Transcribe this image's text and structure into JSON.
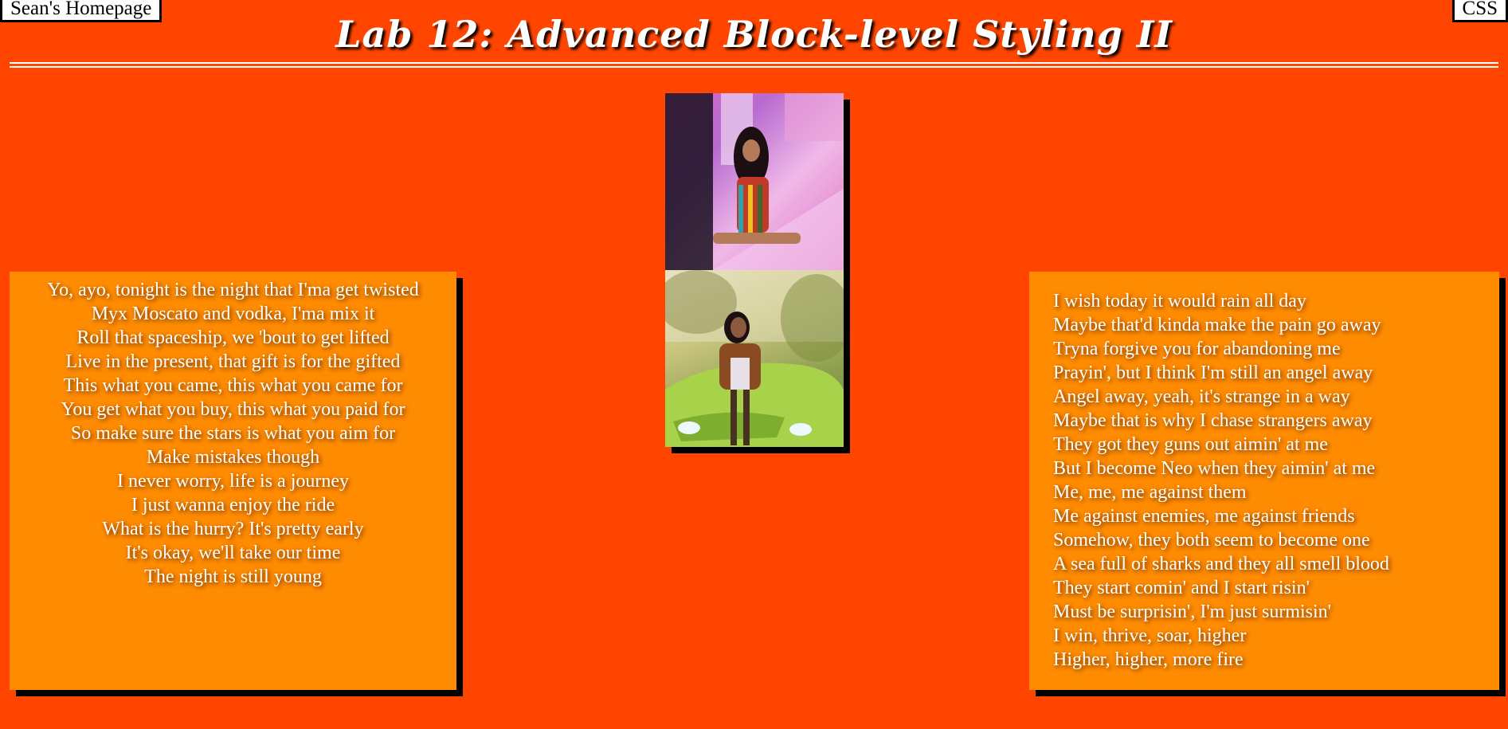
{
  "nav": {
    "home_label": "Sean's Homepage",
    "css_label": "CSS"
  },
  "page_title": "Lab 12: Advanced Block-level Styling II",
  "left_lyrics": [
    "Yo, ayo, tonight is the night that I'ma get twisted",
    "Myx Moscato and vodka, I'ma mix it",
    "Roll that spaceship, we 'bout to get lifted",
    "Live in the present, that gift is for the gifted",
    "This what you came, this what you came for",
    "You get what you buy, this what you paid for",
    "So make sure the stars is what you aim for",
    "Make mistakes though",
    "I never worry, life is a journey",
    "I just wanna enjoy the ride",
    "What is the hurry? It's pretty early",
    "It's okay, we'll take our time",
    "The night is still young"
  ],
  "right_lyrics": [
    "I wish today it would rain all day",
    "Maybe that'd kinda make the pain go away",
    "Tryna forgive you for abandoning me",
    "Prayin', but I think I'm still an angel away",
    "Angel away, yeah, it's strange in a way",
    "Maybe that is why I chase strangers away",
    "They got they guns out aimin' at me",
    "But I become Neo when they aimin' at me",
    "Me, me, me against them",
    "Me against enemies, me against friends",
    "Somehow, they both seem to become one",
    "A sea full of  sharks and they all smell blood",
    "They start comin' and I start risin'",
    "Must be surprisin', I'm just surmisin'",
    "I win, thrive, soar, higher",
    "Higher, higher, more fire"
  ]
}
